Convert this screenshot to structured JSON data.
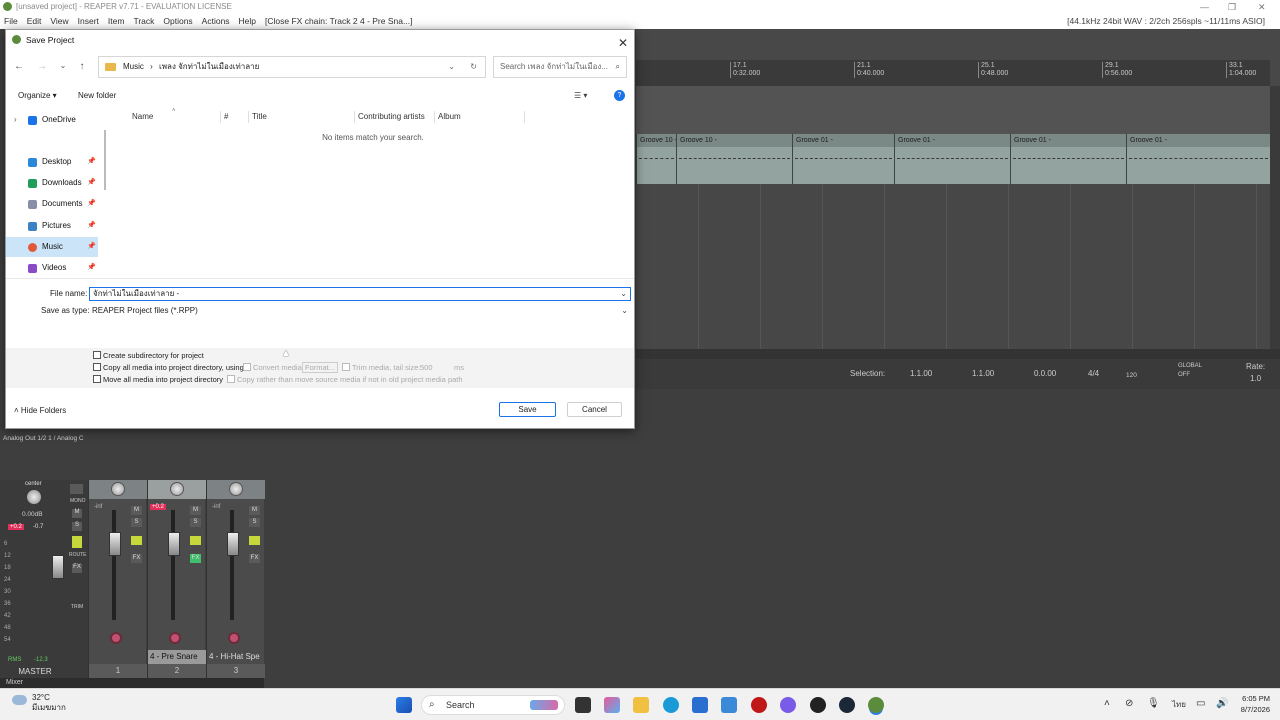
{
  "reaper": {
    "title": "[unsaved project] - REAPER v7.71 - EVALUATION LICENSE",
    "menu": [
      "File",
      "Edit",
      "View",
      "Insert",
      "Item",
      "Track",
      "Options",
      "Actions",
      "Help"
    ],
    "menu_extra": "[Close FX chain: Track 2 4 - Pre Sna...]",
    "status": "[44.1kHz 24bit WAV : 2/2ch 256spls ~11/11ms ASIO]",
    "minimize": "—",
    "restore": "❐",
    "close": "✕"
  },
  "ruler": {
    "marks": [
      {
        "bar": "17.1",
        "time": "0:32.000"
      },
      {
        "bar": "21.1",
        "time": "0:40.000"
      },
      {
        "bar": "25.1",
        "time": "0:48.000"
      },
      {
        "bar": "29.1",
        "time": "0:56.000"
      },
      {
        "bar": "33.1",
        "time": "1:04.000"
      }
    ]
  },
  "items": [
    "Groove 10 -",
    "Groove 10 -",
    "Groove 01 -",
    "Groove 01 -",
    "Groove 01 -",
    "Groove 01 -"
  ],
  "transport": {
    "selection_label": "Selection:",
    "start": "1.1.00",
    "end": "1.1.00",
    "length": "0.0.00",
    "time_sig": "4/4",
    "bpm": "120",
    "global": "GLOBAL",
    "global_off": "OFF",
    "rate_label": "Rate:",
    "rate": "1.0"
  },
  "mixer": {
    "header": "Analog Out 1/2 1 / Analog C",
    "master_label": "MASTER",
    "center": "center",
    "master_db": "0.00dB",
    "master_peak_l": "+0.2",
    "master_peak_r": "-0.7",
    "rms_label": "RMS",
    "rms_value": "-12.3",
    "mono": "MONO",
    "route": "ROUTE",
    "trim": "TRIM",
    "bar_label": "Mixer",
    "scale": [
      "6",
      "12",
      "18",
      "24",
      "30",
      "36",
      "42",
      "48",
      "54"
    ],
    "strips": [
      {
        "name": "",
        "num": "1",
        "peak": "-inf"
      },
      {
        "name": "4 - Pre Snare",
        "num": "2",
        "peak": "+0.2"
      },
      {
        "name": "4 - Hi-Hat Spe",
        "num": "3",
        "peak": "-inf"
      }
    ]
  },
  "dialog": {
    "title": "Save Project",
    "breadcrumb_root": "Music",
    "breadcrumb_folder": "เพลง จักท่าไม่ในเมืองเท่าลาย",
    "search_placeholder": "Search เพลง จักท่าไม่ในเมือง...",
    "organize": "Organize ▾",
    "new_folder": "New folder",
    "nav_items": [
      {
        "label": "OneDrive",
        "color": "#1a73e8"
      },
      {
        "label": "Desktop",
        "color": "#2b88d8"
      },
      {
        "label": "Downloads",
        "color": "#1e9e5a"
      },
      {
        "label": "Documents",
        "color": "#8a8fa8"
      },
      {
        "label": "Pictures",
        "color": "#3b82c4"
      },
      {
        "label": "Music",
        "color": "#e05a3a"
      },
      {
        "label": "Videos",
        "color": "#8a4cc6"
      }
    ],
    "columns": [
      "Name",
      "#",
      "Title",
      "Contributing artists",
      "Album"
    ],
    "empty_message": "No items match your search.",
    "file_name_label": "File name:",
    "file_name_value": "จักท่าไม่ในเมืองเท่าลาย -",
    "save_type_label": "Save as type:",
    "save_type_value": "REAPER Project files (*.RPP)",
    "opt_subdir": "Create subdirectory for project",
    "opt_copy": "Copy all media into project directory, using:",
    "opt_convert": "Convert media",
    "opt_format": "Format...",
    "opt_trim": "Trim media, tail size:",
    "opt_tail": "500",
    "opt_ms": "ms",
    "opt_move": "Move all media into project directory",
    "opt_copy_rather": "Copy rather than move source media if not in old project media path",
    "hide_folders": "Hide Folders",
    "save_button": "Save",
    "cancel_button": "Cancel"
  },
  "taskbar": {
    "temp": "32°C",
    "weather": "มีเมฆมาก",
    "search": "Search",
    "lang": "ไทย",
    "time": "6:05 PM",
    "date": "8/7/2026"
  }
}
